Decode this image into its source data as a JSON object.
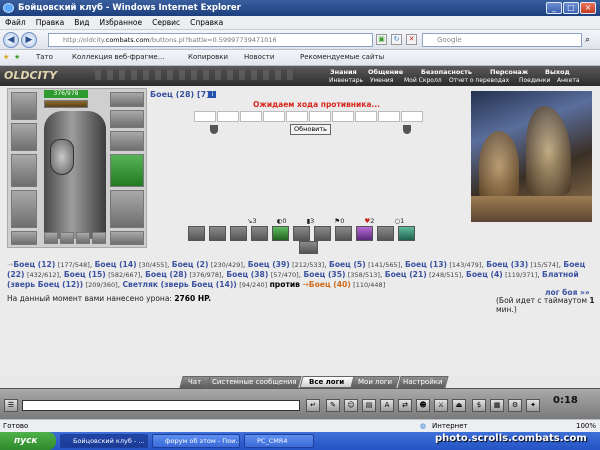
{
  "window": {
    "title": "Бойцовский клуб - Windows Internet Explorer",
    "min": "_",
    "max": "□",
    "close": "×"
  },
  "menu": [
    "Файл",
    "Правка",
    "Вид",
    "Избранное",
    "Сервис",
    "Справка"
  ],
  "address": {
    "url_prefix": "http://oldcity.",
    "url_domain": "combats.com",
    "url_path": "/buttons.pl?battle=0.59997739471016",
    "search_placeholder": "Google"
  },
  "favbar": {
    "tato": "Тато",
    "collection": "Коллекция веб-фрагме...",
    "copy": "Копировки",
    "news": "Новости",
    "recommended": "Рекомендуемые сайты"
  },
  "game_header": {
    "logo": "OLDCITY",
    "nav": [
      "Знания",
      "Общение",
      "Безопасность",
      "Персонаж",
      "Выход"
    ],
    "subnav": [
      "Инвентарь",
      "Умения",
      "Мой Скролл",
      "Отчет о переводах",
      "Поединки",
      "Анкета"
    ]
  },
  "player": {
    "title": "Боец",
    "level": "(28)",
    "extra": "[7]",
    "hp": "376/978"
  },
  "battle": {
    "waiting": "Ожидаем хода противника...",
    "refresh": "Обновить",
    "counts": [
      "3",
      "0",
      "3",
      "0",
      "2",
      "1"
    ],
    "damage_label": "На данный момент вами нанесено урона:",
    "damage_value": "2760 HP.",
    "log_link": "лог боя »»",
    "timeout_prefix": "(Бой идет с таймаутом",
    "timeout_value": "1",
    "timeout_suffix": "мин.)",
    "vs": "против"
  },
  "team1": [
    {
      "name": "Боец (12)",
      "hp": "[177/548]"
    },
    {
      "name": "Боец (14)",
      "hp": "[30/455]"
    },
    {
      "name": "Боец (2)",
      "hp": "[230/429]"
    },
    {
      "name": "Боец (39)",
      "hp": "[212/533]"
    },
    {
      "name": "Боец (5)",
      "hp": "[141/565]"
    },
    {
      "name": "Боец (13)",
      "hp": "[143/479]"
    },
    {
      "name": "Боец (33)",
      "hp": "[15/574]"
    },
    {
      "name": "Боец (22)",
      "hp": "[432/612]"
    },
    {
      "name": "Боец (15)",
      "hp": "[582/667]"
    },
    {
      "name": "Боец (28)",
      "hp": "[376/978]"
    },
    {
      "name": "Боец (38)",
      "hp": "[57/470]"
    },
    {
      "name": "Боец (35)",
      "hp": "[358/513]"
    },
    {
      "name": "Боец (21)",
      "hp": "[248/515]"
    },
    {
      "name": "Боец (4)",
      "hp": "[119/371]"
    },
    {
      "name": "Блатной (зверь Боец (12))",
      "hp": "[209/360]"
    },
    {
      "name": "Светляк (зверь Боец (14))",
      "hp": "[94/240]"
    }
  ],
  "team2": [
    {
      "name": "Боец (40)",
      "hp": "[110/448]"
    }
  ],
  "chat_tabs": [
    "Чат",
    "Системные сообщения",
    "Все логи",
    "Мои логи",
    "Настройки"
  ],
  "clock": "0:18",
  "status": {
    "ready": "Готово",
    "zone": "Интернет",
    "zoom": "100%"
  },
  "taskbar": {
    "start": "пуск",
    "tasks": [
      "Бойцовский клуб - ...",
      "форум об этом - Пои...",
      "PC_CMR4"
    ]
  },
  "watermark": "photo.scrolls.combats.com"
}
